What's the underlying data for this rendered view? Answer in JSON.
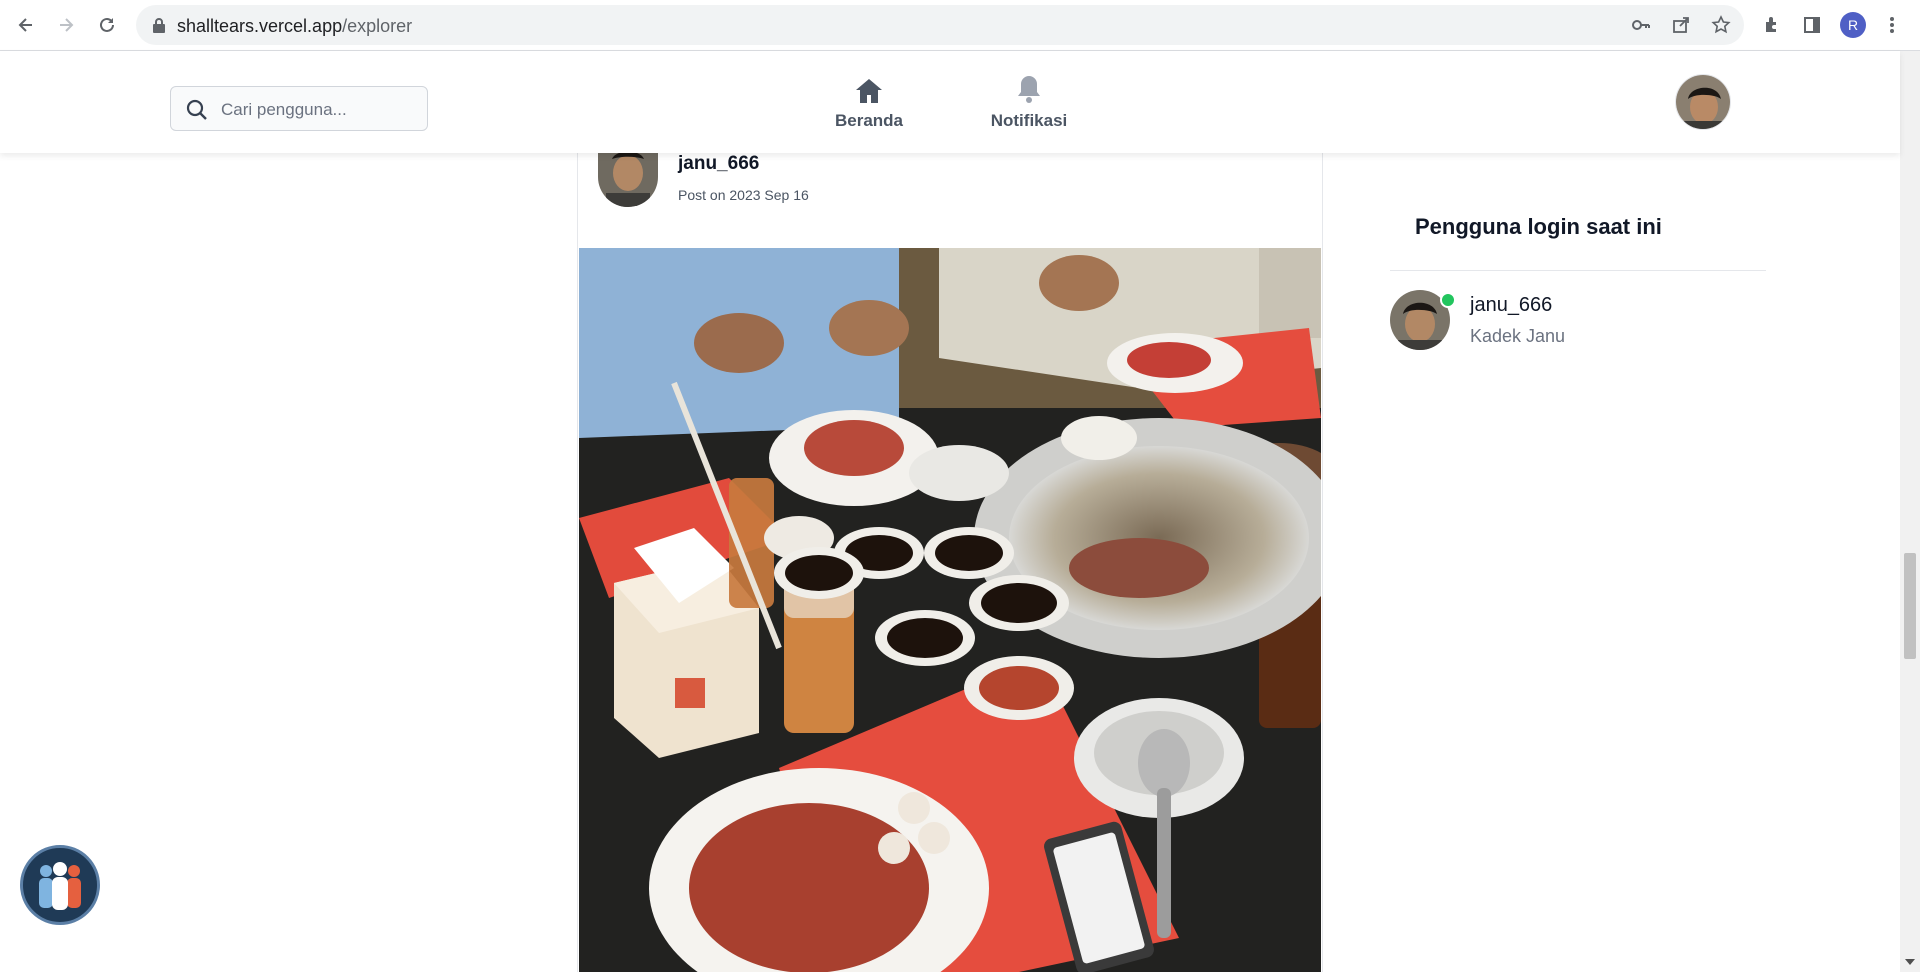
{
  "browser": {
    "url_domain": "shalltears.vercel.app",
    "url_path": "/explorer",
    "profile_initial": "R"
  },
  "header": {
    "search_placeholder": "Cari pengguna...",
    "nav": [
      {
        "label": "Beranda",
        "icon": "home-icon"
      },
      {
        "label": "Notifikasi",
        "icon": "bell-icon"
      }
    ]
  },
  "post": {
    "username": "janu_666",
    "date": "Post on 2023 Sep 16",
    "image_alt": "Korean BBQ dinner table with grill, sauces and plates of meat"
  },
  "sidebar": {
    "title": "Pengguna login saat ini",
    "users": [
      {
        "username": "janu_666",
        "full_name": "Kadek Janu",
        "status": "online"
      }
    ]
  },
  "colors": {
    "online": "#22c55e",
    "nav_text": "#4b5563",
    "float_button": "#1f3a56",
    "accent_red": "#e74c3c"
  }
}
